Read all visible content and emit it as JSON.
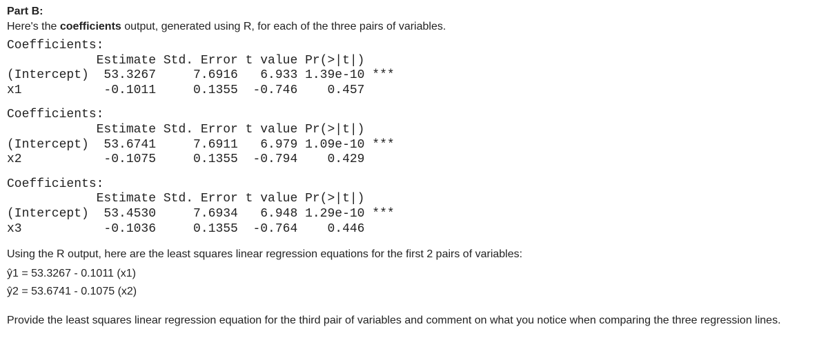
{
  "heading": "Part B:",
  "intro_pre": "Here's the ",
  "intro_bold": "coefficients",
  "intro_post": " output, generated using R, for each of the three pairs of variables.",
  "blocks": [
    {
      "title": "Coefficients:",
      "header": "            Estimate Std. Error t value Pr(>|t|)",
      "row1": "(Intercept)  53.3267     7.6916   6.933 1.39e-10 ***",
      "row2": "x1           -0.1011     0.1355  -0.746    0.457"
    },
    {
      "title": "Coefficients:",
      "header": "            Estimate Std. Error t value Pr(>|t|)",
      "row1": "(Intercept)  53.6741     7.6911   6.979 1.09e-10 ***",
      "row2": "x2           -0.1075     0.1355  -0.794    0.429"
    },
    {
      "title": "Coefficients:",
      "header": "            Estimate Std. Error t value Pr(>|t|)",
      "row1": "(Intercept)  53.4530     7.6934   6.948 1.29e-10 ***",
      "row2": "x3           -0.1036     0.1355  -0.764    0.446"
    }
  ],
  "explain": "Using the R output, here are the least squares linear regression equations for the first 2 pairs of variables:",
  "eq1": "ŷ1 = 53.3267 - 0.1011 (x1)",
  "eq2": "ŷ2 = 53.6741 - 0.1075 (x2)",
  "question": "Provide the least squares linear regression equation for the third pair of variables and comment on what you notice when comparing the three regression lines."
}
